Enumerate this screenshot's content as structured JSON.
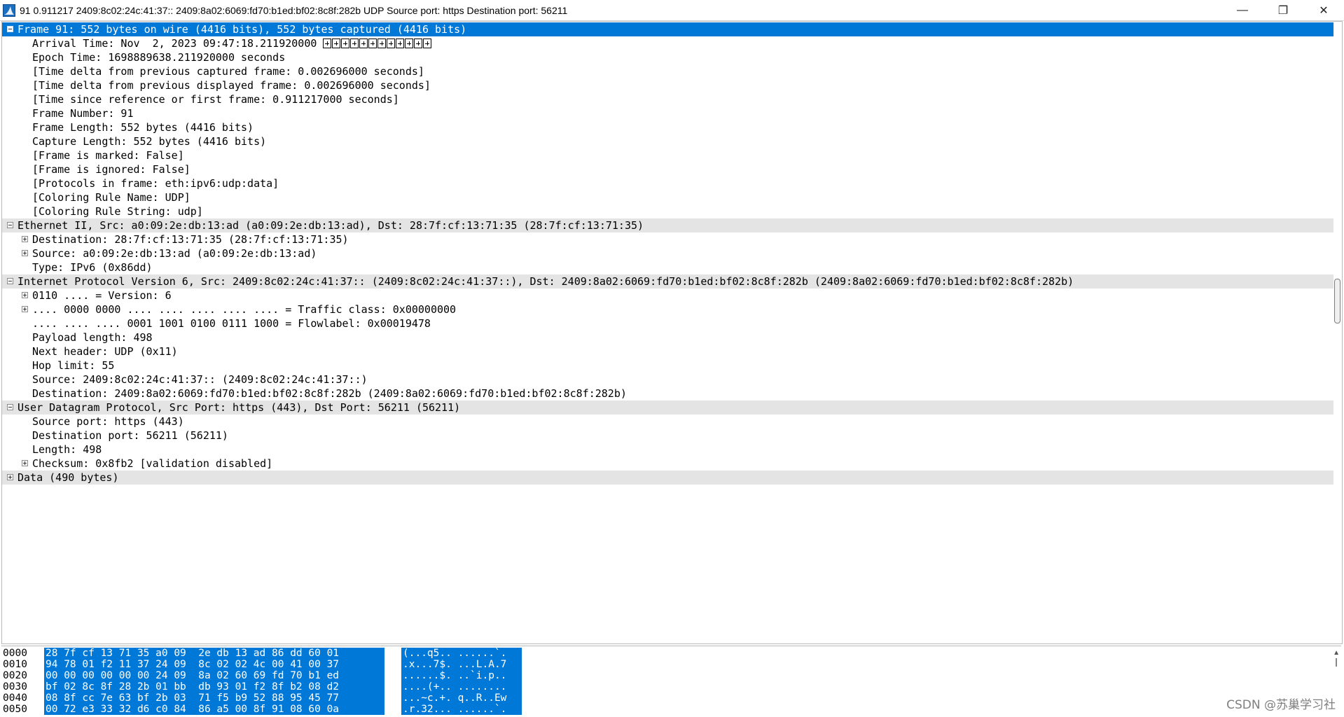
{
  "window": {
    "title": "91 0.911217 2409:8c02:24c:41:37:: 2409:8a02:6069:fd70:b1ed:bf02:8c8f:282b UDP Source port: https  Destination port: 56211",
    "app_icon": "wireshark-fin-icon",
    "minimize_glyph": "—",
    "restore_glyph": "❐",
    "close_glyph": "✕"
  },
  "tree": [
    {
      "text": "Frame 91: 552 bytes on wire (4416 bits), 552 bytes captured (4416 bits)",
      "level": 0,
      "expander": "minus",
      "header": true,
      "selected": true
    },
    {
      "text": "Arrival Time: Nov  2, 2023 09:47:18.211920000 ",
      "level": 1,
      "glyph_boxes": 12
    },
    {
      "text": "Epoch Time: 1698889638.211920000 seconds",
      "level": 1
    },
    {
      "text": "[Time delta from previous captured frame: 0.002696000 seconds]",
      "level": 1
    },
    {
      "text": "[Time delta from previous displayed frame: 0.002696000 seconds]",
      "level": 1
    },
    {
      "text": "[Time since reference or first frame: 0.911217000 seconds]",
      "level": 1
    },
    {
      "text": "Frame Number: 91",
      "level": 1
    },
    {
      "text": "Frame Length: 552 bytes (4416 bits)",
      "level": 1
    },
    {
      "text": "Capture Length: 552 bytes (4416 bits)",
      "level": 1
    },
    {
      "text": "[Frame is marked: False]",
      "level": 1
    },
    {
      "text": "[Frame is ignored: False]",
      "level": 1
    },
    {
      "text": "[Protocols in frame: eth:ipv6:udp:data]",
      "level": 1
    },
    {
      "text": "[Coloring Rule Name: UDP]",
      "level": 1
    },
    {
      "text": "[Coloring Rule String: udp]",
      "level": 1
    },
    {
      "text": "Ethernet II, Src: a0:09:2e:db:13:ad (a0:09:2e:db:13:ad), Dst: 28:7f:cf:13:71:35 (28:7f:cf:13:71:35)",
      "level": 0,
      "expander": "minus",
      "header": true
    },
    {
      "text": "Destination: 28:7f:cf:13:71:35 (28:7f:cf:13:71:35)",
      "level": 1,
      "expander": "plus"
    },
    {
      "text": "Source: a0:09:2e:db:13:ad (a0:09:2e:db:13:ad)",
      "level": 1,
      "expander": "plus"
    },
    {
      "text": "Type: IPv6 (0x86dd)",
      "level": 1
    },
    {
      "text": "Internet Protocol Version 6, Src: 2409:8c02:24c:41:37:: (2409:8c02:24c:41:37::), Dst: 2409:8a02:6069:fd70:b1ed:bf02:8c8f:282b (2409:8a02:6069:fd70:b1ed:bf02:8c8f:282b)",
      "level": 0,
      "expander": "minus",
      "header": true
    },
    {
      "text": "0110 .... = Version: 6",
      "level": 1,
      "expander": "plus"
    },
    {
      "text": ".... 0000 0000 .... .... .... .... .... = Traffic class: 0x00000000",
      "level": 1,
      "expander": "plus"
    },
    {
      "text": ".... .... .... 0001 1001 0100 0111 1000 = Flowlabel: 0x00019478",
      "level": 1
    },
    {
      "text": "Payload length: 498",
      "level": 1
    },
    {
      "text": "Next header: UDP (0x11)",
      "level": 1
    },
    {
      "text": "Hop limit: 55",
      "level": 1
    },
    {
      "text": "Source: 2409:8c02:24c:41:37:: (2409:8c02:24c:41:37::)",
      "level": 1
    },
    {
      "text": "Destination: 2409:8a02:6069:fd70:b1ed:bf02:8c8f:282b (2409:8a02:6069:fd70:b1ed:bf02:8c8f:282b)",
      "level": 1
    },
    {
      "text": "User Datagram Protocol, Src Port: https (443), Dst Port: 56211 (56211)",
      "level": 0,
      "expander": "minus",
      "header": true
    },
    {
      "text": "Source port: https (443)",
      "level": 1
    },
    {
      "text": "Destination port: 56211 (56211)",
      "level": 1
    },
    {
      "text": "Length: 498",
      "level": 1
    },
    {
      "text": "Checksum: 0x8fb2 [validation disabled]",
      "level": 1,
      "expander": "plus"
    },
    {
      "text": "Data (490 bytes)",
      "level": 0,
      "expander": "plus",
      "header": true
    }
  ],
  "hex": [
    {
      "offset": "0000",
      "bytes": "28 7f cf 13 71 35 a0 09  2e db 13 ad 86 dd 60 01",
      "ascii": "(...q5.. ......`."
    },
    {
      "offset": "0010",
      "bytes": "94 78 01 f2 11 37 24 09  8c 02 02 4c 00 41 00 37",
      "ascii": ".x...7$. ...L.A.7"
    },
    {
      "offset": "0020",
      "bytes": "00 00 00 00 00 00 24 09  8a 02 60 69 fd 70 b1 ed",
      "ascii": "......$. ..`i.p.."
    },
    {
      "offset": "0030",
      "bytes": "bf 02 8c 8f 28 2b 01 bb  db 93 01 f2 8f b2 08 d2",
      "ascii": "....(+.. ........"
    },
    {
      "offset": "0040",
      "bytes": "08 8f cc 7e 63 bf 2b 03  71 f5 b9 52 88 95 45 77",
      "ascii": "...~c.+. q..R..Ew"
    },
    {
      "offset": "0050",
      "bytes": "00 72 e3 33 32 d6 c0 84  86 a5 00 8f 91 08 60 0a",
      "ascii": ".r.32... ......`."
    }
  ],
  "watermark": "CSDN @苏巢学习社"
}
